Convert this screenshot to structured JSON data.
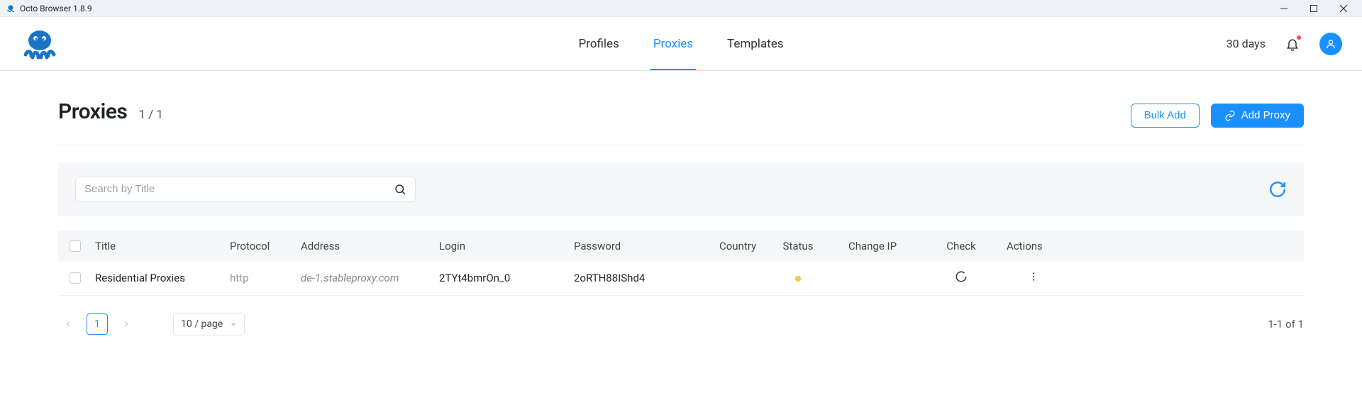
{
  "window": {
    "title": "Octo Browser 1.8.9"
  },
  "header": {
    "tabs": {
      "profiles": "Profiles",
      "proxies": "Proxies",
      "templates": "Templates"
    },
    "days": "30 days"
  },
  "page": {
    "title": "Proxies",
    "count": "1 / 1",
    "bulk_add": "Bulk Add",
    "add_proxy": "Add Proxy",
    "search_placeholder": "Search by Title"
  },
  "columns": {
    "title": "Title",
    "protocol": "Protocol",
    "address": "Address",
    "login": "Login",
    "password": "Password",
    "country": "Country",
    "status": "Status",
    "changeip": "Change IP",
    "check": "Check",
    "actions": "Actions"
  },
  "rows": [
    {
      "title": "Residential Proxies",
      "protocol": "http",
      "address": "de-1.stableproxy.com",
      "login": "2TYt4bmrOn_0",
      "password": "2oRTH88IShd4"
    }
  ],
  "pagination": {
    "current": "1",
    "page_size": "10 / page",
    "summary": "1-1 of 1"
  }
}
